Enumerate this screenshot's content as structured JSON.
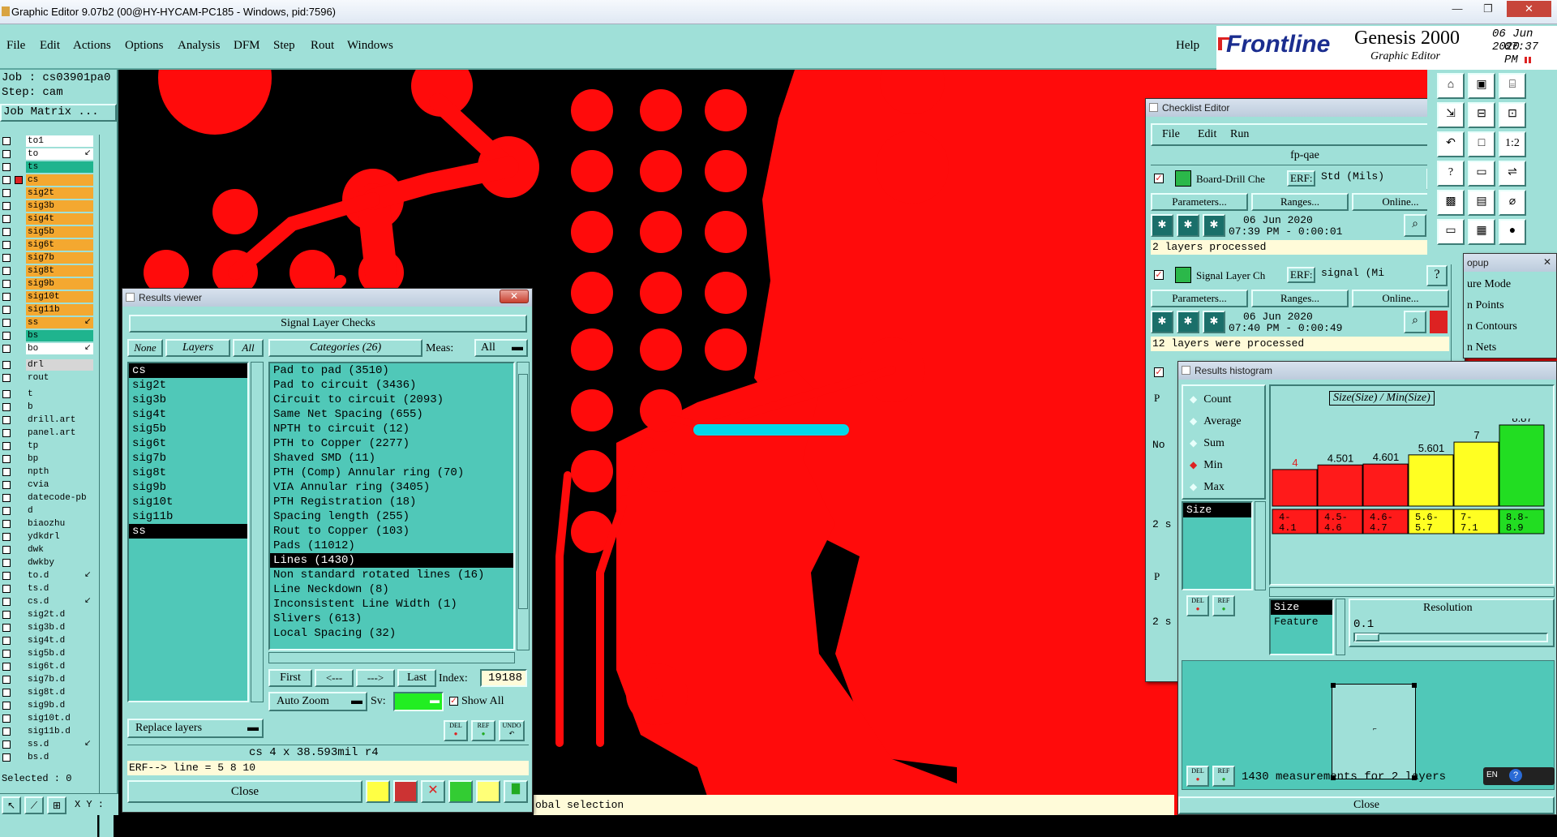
{
  "app": {
    "title": "Graphic Editor 9.07b2 (00@HY-HYCAM-PC185 - Windows, pid:7596)",
    "menu": [
      "File",
      "Edit",
      "Actions",
      "Options",
      "Analysis",
      "DFM",
      "Step",
      "Rout",
      "Windows"
    ],
    "help": "Help",
    "brand": "Frontline",
    "product": "Genesis 2000",
    "subtitle": "Graphic Editor",
    "date": "06 Jun 2020",
    "time": "07:37 PM"
  },
  "left_panel": {
    "job": "Job : cs03901pa0",
    "step": "Step: cam",
    "job_matrix": "Job Matrix ...",
    "layers": [
      {
        "name": "to1",
        "color": "#ffffff"
      },
      {
        "name": "to",
        "color": "#ffffff",
        "mark": "arrow"
      },
      {
        "name": "ts",
        "color": "#1fb48e"
      },
      {
        "name": "cs",
        "color": "#f4a830",
        "active": true
      },
      {
        "name": "sig2t",
        "color": "#f4a830"
      },
      {
        "name": "sig3b",
        "color": "#f4a830"
      },
      {
        "name": "sig4t",
        "color": "#f4a830"
      },
      {
        "name": "sig5b",
        "color": "#f4a830"
      },
      {
        "name": "sig6t",
        "color": "#f4a830"
      },
      {
        "name": "sig7b",
        "color": "#f4a830"
      },
      {
        "name": "sig8t",
        "color": "#f4a830"
      },
      {
        "name": "sig9b",
        "color": "#f4a830"
      },
      {
        "name": "sig10t",
        "color": "#f4a830"
      },
      {
        "name": "sig11b",
        "color": "#f4a830"
      },
      {
        "name": "ss",
        "color": "#f4a830",
        "mark": "arrow"
      },
      {
        "name": "bs",
        "color": "#1fb48e"
      },
      {
        "name": "bo",
        "color": "#ffffff",
        "mark": "arrow"
      },
      {
        "name": "drl",
        "color": "#d6d6d6"
      },
      {
        "name": "rout",
        "color": "#9fe0d8"
      },
      {
        "name": "t",
        "color": "#9fe0d8"
      },
      {
        "name": "b",
        "color": "#9fe0d8"
      },
      {
        "name": "drill.art",
        "color": "#9fe0d8"
      },
      {
        "name": "panel.art",
        "color": "#9fe0d8"
      },
      {
        "name": "tp",
        "color": "#9fe0d8"
      },
      {
        "name": "bp",
        "color": "#9fe0d8"
      },
      {
        "name": "npth",
        "color": "#9fe0d8"
      },
      {
        "name": "cvia",
        "color": "#9fe0d8"
      },
      {
        "name": "datecode-pb",
        "color": "#9fe0d8"
      },
      {
        "name": "d",
        "color": "#9fe0d8"
      },
      {
        "name": "biaozhu",
        "color": "#9fe0d8"
      },
      {
        "name": "ydkdrl",
        "color": "#9fe0d8"
      },
      {
        "name": "dwk",
        "color": "#9fe0d8"
      },
      {
        "name": "dwkby",
        "color": "#9fe0d8"
      },
      {
        "name": "to.d",
        "color": "#9fe0d8",
        "mark": "arrow"
      },
      {
        "name": "ts.d",
        "color": "#9fe0d8"
      },
      {
        "name": "cs.d",
        "color": "#9fe0d8",
        "mark": "arrow"
      },
      {
        "name": "sig2t.d",
        "color": "#9fe0d8"
      },
      {
        "name": "sig3b.d",
        "color": "#9fe0d8"
      },
      {
        "name": "sig4t.d",
        "color": "#9fe0d8"
      },
      {
        "name": "sig5b.d",
        "color": "#9fe0d8"
      },
      {
        "name": "sig6t.d",
        "color": "#9fe0d8"
      },
      {
        "name": "sig7b.d",
        "color": "#9fe0d8"
      },
      {
        "name": "sig8t.d",
        "color": "#9fe0d8"
      },
      {
        "name": "sig9b.d",
        "color": "#9fe0d8"
      },
      {
        "name": "sig10t.d",
        "color": "#9fe0d8"
      },
      {
        "name": "sig11b.d",
        "color": "#9fe0d8"
      },
      {
        "name": "ss.d",
        "color": "#9fe0d8",
        "mark": "arrow"
      },
      {
        "name": "bs.d",
        "color": "#9fe0d8"
      }
    ],
    "selected": "Selected : 0",
    "xy": "X Y :"
  },
  "status_line": "obal selection",
  "results_viewer": {
    "title": "Results viewer",
    "header": "Signal Layer Checks",
    "none": "None",
    "layers_label": "Layers",
    "all": "All",
    "categories_label": "Categories (26)",
    "meas_label": "Meas:",
    "meas_value": "All",
    "layers": [
      "cs",
      "sig2t",
      "sig3b",
      "sig4t",
      "sig5b",
      "sig6t",
      "sig7b",
      "sig8t",
      "sig9b",
      "sig10t",
      "sig11b",
      "ss"
    ],
    "categories": [
      "Pad to pad (3510)",
      "Pad to circuit (3436)",
      "Circuit to circuit (2093)",
      "Same Net Spacing (655)",
      "NPTH to circuit (12)",
      "PTH to Copper (2277)",
      "Shaved SMD (11)",
      "PTH (Comp) Annular ring (70)",
      "VIA Annular ring (3405)",
      "PTH Registration (18)",
      "Spacing length (255)",
      "Rout to Copper (103)",
      "Pads (11012)",
      "Lines (1430)",
      "Non standard rotated lines (16)",
      "Line Neckdown (8)",
      "Inconsistent Line Width (1)",
      "Slivers (613)",
      "Local Spacing (32)"
    ],
    "selected_category": "Lines (1430)",
    "first": "First",
    "prev": "<---",
    "next": "--->",
    "last": "Last",
    "index_label": "Index:",
    "index_value": "19188",
    "auto_zoom": "Auto Zoom",
    "sv_label": "Sv:",
    "show_all": "Show All",
    "replace_layers": "Replace layers",
    "info": "cs 4 x 38.593mil  r4",
    "erf": "ERF--> line = 5 8 10",
    "close": "Close",
    "del": "DEL",
    "ref": "REF",
    "undo": "UNDO"
  },
  "checklist_editor": {
    "title": "Checklist Editor",
    "menu": [
      "File",
      "Edit",
      "Run"
    ],
    "checklist_name": "fp-qae",
    "checks": [
      {
        "name": "Board-Drill Che",
        "erf_label": "ERF:",
        "erf_value": "Std (Mils)",
        "params": "Parameters...",
        "ranges": "Ranges...",
        "online": "Online...",
        "date": "06 Jun 2020",
        "time": "07:39 PM - 0:00:01",
        "status": "2 layers processed"
      },
      {
        "name": "Signal Layer Ch",
        "erf_label": "ERF:",
        "erf_value": "signal (Mi",
        "params": "Parameters...",
        "ranges": "Ranges...",
        "online": "Online...",
        "date": "06 Jun 2020",
        "time": "07:40 PM - 0:00:49",
        "status": "12 layers were processed"
      }
    ],
    "partial_labels": [
      "P",
      "No",
      "2 s",
      "P",
      "2 s"
    ]
  },
  "popup": {
    "title": "opup",
    "items": [
      "ure Mode",
      "n Points",
      "n Contours",
      "n Nets"
    ]
  },
  "histogram": {
    "title": "Results histogram",
    "modes": [
      "Count",
      "Average",
      "Sum",
      "Min",
      "Max"
    ],
    "selected_mode": "Min",
    "attr_list": [
      "Size"
    ],
    "chart_title": "Size(Size) / Min(Size)",
    "x_attr": [
      "Size",
      "Feature"
    ],
    "resolution_label": "Resolution",
    "resolution_value": "0.1",
    "summary": "1430 measurements for 2 layers",
    "close": "Close",
    "del": "DEL",
    "ref": "REF",
    "lang": "EN"
  },
  "chart_data": {
    "type": "bar",
    "title": "Size(Size) / Min(Size)",
    "categories": [
      "4-\n4.1",
      "4.5-\n4.6",
      "4.6-\n4.7",
      "5.6-\n5.7",
      "7-\n7.1",
      "8.8-\n8.9"
    ],
    "values": [
      4,
      4.501,
      4.601,
      5.601,
      7,
      8.87
    ],
    "labels": [
      "4",
      "4.501",
      "4.601",
      "5.601",
      "7",
      "8.87"
    ],
    "colors": [
      "#ff1a1a",
      "#ff1a1a",
      "#ff1a1a",
      "#ffff22",
      "#ffff22",
      "#22dd22"
    ],
    "ylim": [
      0,
      8.87
    ]
  }
}
